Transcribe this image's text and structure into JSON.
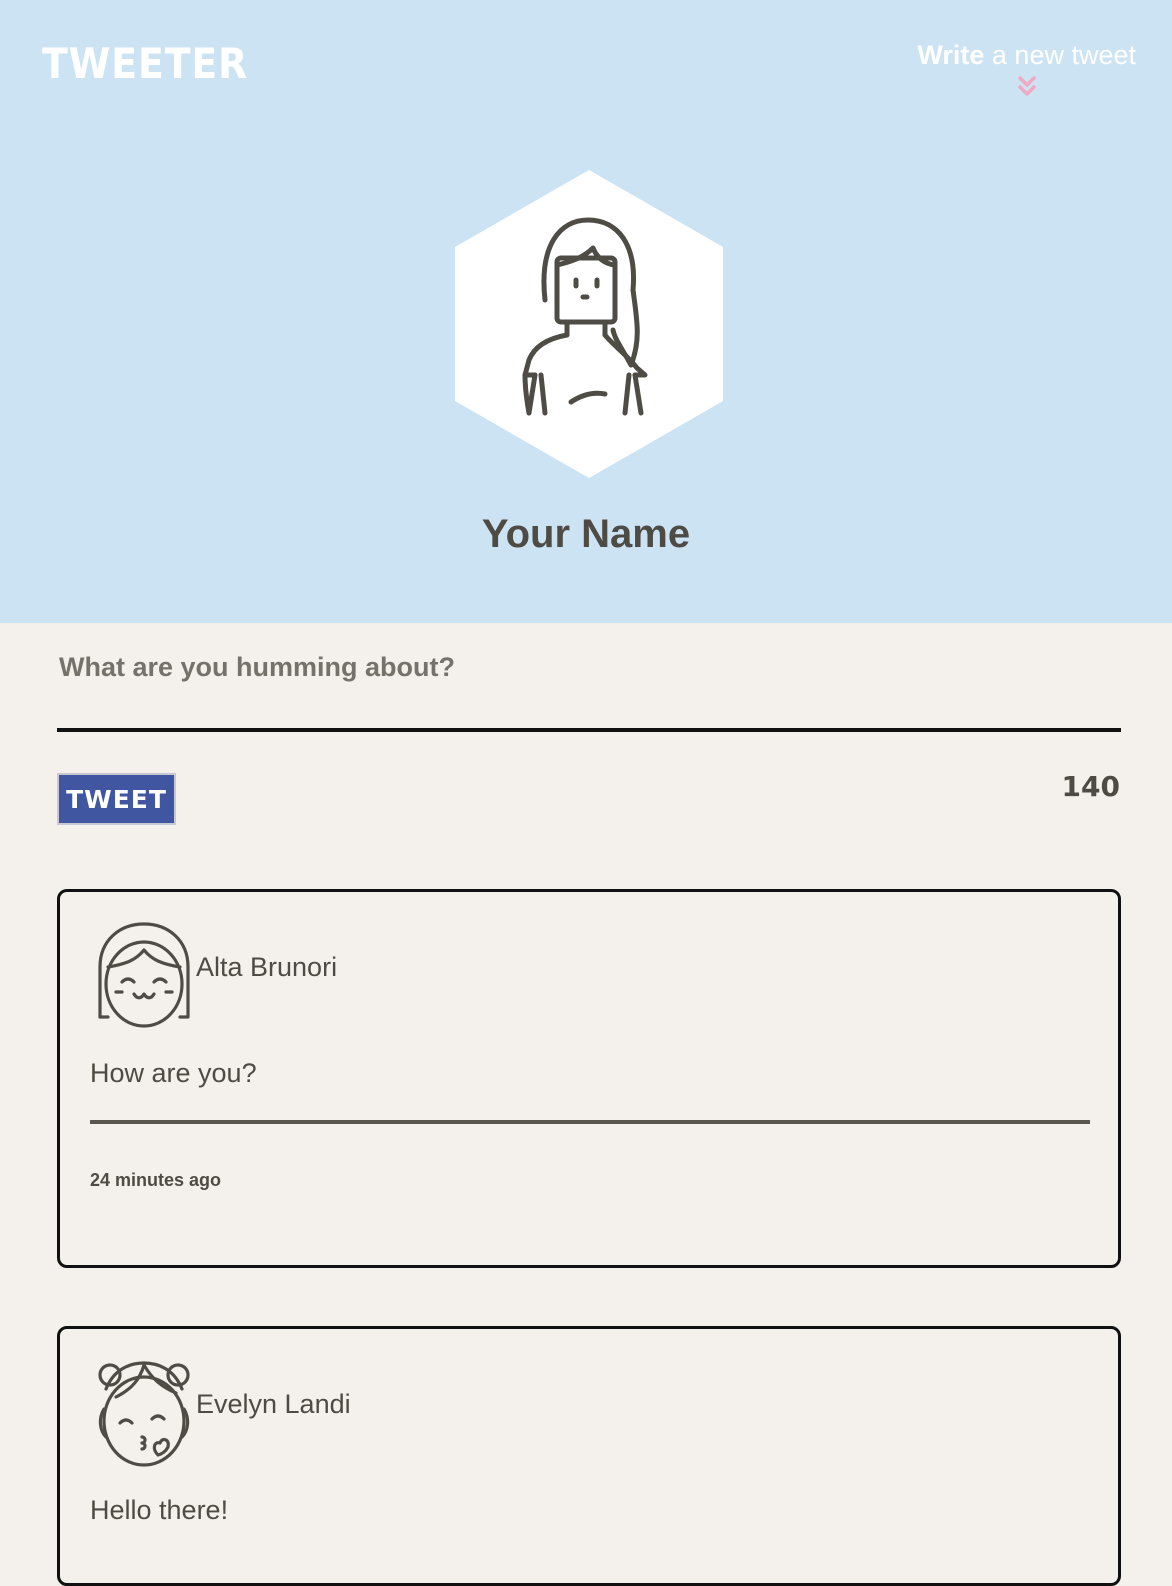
{
  "header": {
    "logo": "TWEETER",
    "compose_bold": "Write",
    "compose_rest": " a new tweet",
    "chevron_icon": "double-chevron-down-icon",
    "chevron_color": "#f0a9c3",
    "background": "#cce3f4"
  },
  "profile": {
    "name": "Your Name",
    "avatar_icon": "woman-avatar-icon"
  },
  "composer": {
    "placeholder": "What are you humming about?",
    "button_label": "TWEET",
    "button_color": "#4056a1",
    "counter": "140"
  },
  "tweets": [
    {
      "author": "Alta Brunori",
      "avatar_icon": "girl-smiling-avatar-icon",
      "content": "How are you?",
      "timestamp": "24 minutes ago"
    },
    {
      "author": "Evelyn Landi",
      "avatar_icon": "girl-kiss-avatar-icon",
      "content": "Hello there!"
    }
  ]
}
